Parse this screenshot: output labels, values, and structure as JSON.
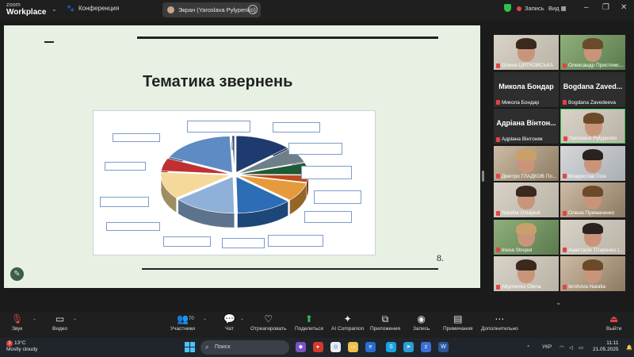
{
  "topbar": {
    "logo_line1": "zoom",
    "logo_line2": "Workplace",
    "meeting_label": "Конференция",
    "share_label": "Экран (Yaroslava Pylypenko)",
    "record_label": "Запись",
    "view_label": "Вид"
  },
  "slide": {
    "title": "Тематика звернень",
    "page_number": "8."
  },
  "chart_data": {
    "type": "pie",
    "title": "",
    "note": "3D exploded pie chart embedded in slide; callout text is illegible at this resolution",
    "slices": [
      {
        "color": "#1f3a6e",
        "value": 13.2
      },
      {
        "color": "#6e7f8a",
        "value": 6.8
      },
      {
        "color": "#1e5a34",
        "value": 5.2
      },
      {
        "color": "#c04a20",
        "value": 3.1
      },
      {
        "color": "#e59b3c",
        "value": 8.4
      },
      {
        "color": "#2d6db5",
        "value": 13.0
      },
      {
        "color": "#8fb0d8",
        "value": 14.6
      },
      {
        "color": "#f5d99a",
        "value": 12.0
      },
      {
        "color": "#bf3030",
        "value": 5.7
      },
      {
        "color": "#5e8bc4",
        "value": 17.4
      },
      {
        "color": "#3d4a7a",
        "value": 0.6
      }
    ]
  },
  "participants": [
    {
      "name": "Олена ЦЯТКОВСЬКА",
      "big": "",
      "photo": "ph-light",
      "active": false
    },
    {
      "name": "Олександр Пристемс...",
      "big": "",
      "photo": "ph-green",
      "active": false
    },
    {
      "name": "Микола Бондар",
      "big": "Микола Бондар",
      "photo": "",
      "active": false
    },
    {
      "name": "Bogdana Zavedeeva",
      "big": "Bogdana Zaved...",
      "photo": "",
      "active": false
    },
    {
      "name": "Адріана Вінтоняк",
      "big": "Адріана Вінтон...",
      "photo": "",
      "active": false
    },
    {
      "name": "Yaroslava Pylypenko",
      "big": "",
      "photo": "ph-light",
      "active": true
    },
    {
      "name": "Дмитро ГЛАДКОВ По...",
      "big": "",
      "photo": "ph-warm",
      "active": false
    },
    {
      "name": "Владислав Гога",
      "big": "",
      "photo": "ph-room",
      "active": false
    },
    {
      "name": "Nataliia Ostapiuk",
      "big": "",
      "photo": "ph-light",
      "active": false
    },
    {
      "name": "Олена Примаченко",
      "big": "",
      "photo": "ph-warm",
      "active": false
    },
    {
      "name": "Inesa Strepel",
      "big": "",
      "photo": "ph-green",
      "active": false
    },
    {
      "name": "Анастасія Тітаренко (...",
      "big": "",
      "photo": "ph-light",
      "active": false
    },
    {
      "name": "Akymenko Olena",
      "big": "",
      "photo": "ph-light",
      "active": false
    },
    {
      "name": "Iershova Natalia",
      "big": "",
      "photo": "ph-warm",
      "active": false
    }
  ],
  "toolbar": {
    "audio": "Звук",
    "video": "Видео",
    "participants": "Участники",
    "participants_count": "70",
    "chat": "Чат",
    "react": "Отреагировать",
    "share": "Поделиться",
    "companion": "AI Companion",
    "apps": "Приложения",
    "record": "Запись",
    "notes": "Примечания",
    "more": "Дополнительно",
    "leave": "Выйти"
  },
  "taskbar": {
    "temperature": "13°C",
    "weather": "Mostly cloudy",
    "weather_badge": "3",
    "search": "Поиск",
    "lang": "УКР",
    "time": "11:11",
    "date": "21.05.2025"
  },
  "colors": {
    "active_border": "#3fbf5a",
    "mic_off": "#e04545",
    "share_green": "#2fc04a"
  }
}
